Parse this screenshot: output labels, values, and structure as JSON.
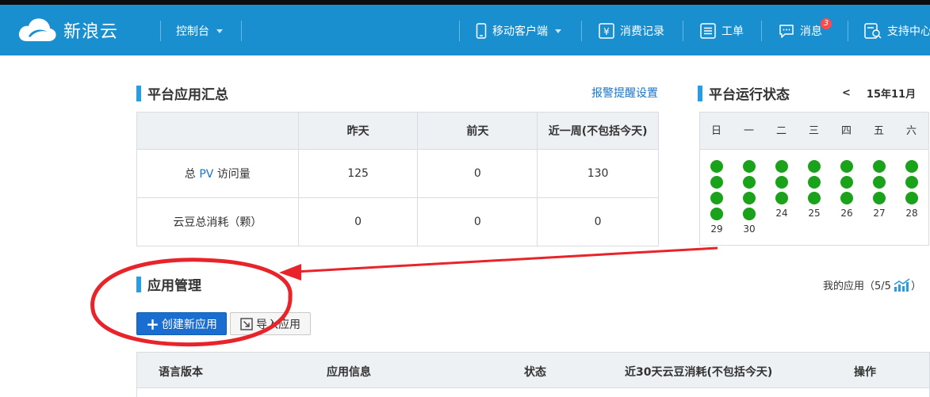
{
  "nav": {
    "logo_text": "新浪云",
    "console": "控制台",
    "mobile": "移动客户端",
    "consumption": "消费记录",
    "ticket": "工单",
    "messages": "消息",
    "message_count": "3",
    "support": "支持中心"
  },
  "summary": {
    "title": "平台应用汇总",
    "alert_link": "报警提醒设置",
    "headers": [
      "",
      "昨天",
      "前天",
      "近一周(不包括今天)"
    ],
    "row1_prefix": "总",
    "row1_pv": "PV",
    "row1_suffix": "访问量",
    "row1_values": [
      "125",
      "0",
      "130"
    ],
    "row2_label": "云豆总消耗（颗）",
    "row2_values": [
      "0",
      "0",
      "0"
    ]
  },
  "status": {
    "title": "平台运行状态",
    "prev": "<",
    "month": "15年11月",
    "next": ">",
    "weekdays": [
      "日",
      "一",
      "二",
      "三",
      "四",
      "五",
      "六"
    ],
    "labels": [
      "24",
      "25",
      "26",
      "27",
      "28",
      "29",
      "30"
    ],
    "status_color": "#1aa31a"
  },
  "apps": {
    "title": "应用管理",
    "my_apps": "我的应用（5/5",
    "my_apps_close": "）",
    "create_button": "创建新应用",
    "import_button": "导入应用",
    "columns": [
      "语言版本",
      "应用信息",
      "状态",
      "近30天云豆消耗(不包括今天)",
      "操作"
    ]
  },
  "colors": {
    "navbar": "#1a8fd0",
    "accent": "#2a9de0",
    "primary_button": "#1a6ed0",
    "annotation": "#e8242a"
  }
}
